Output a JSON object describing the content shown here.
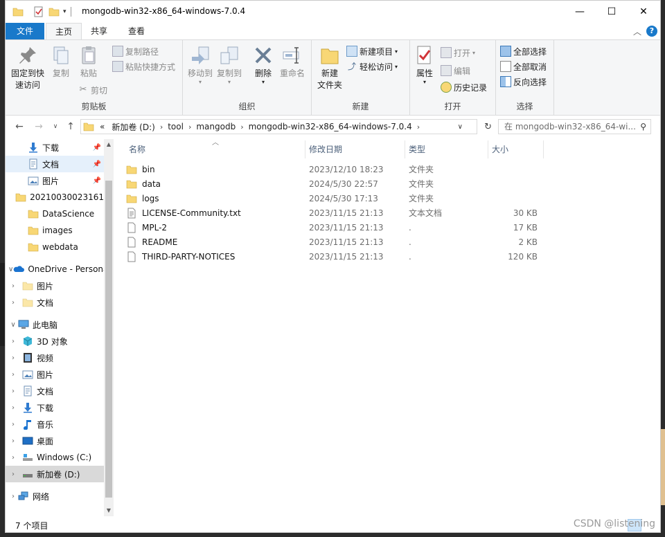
{
  "window": {
    "title": "mongodb-win32-x86_64-windows-7.0.4",
    "controls": {
      "minimize": "—",
      "maximize": "☐",
      "close": "✕"
    }
  },
  "ribbon_tabs": {
    "file": "文件",
    "home": "主页",
    "share": "共享",
    "view": "查看"
  },
  "ribbon": {
    "clipboard": {
      "pin_quick_access": [
        "固定到快",
        "速访问"
      ],
      "copy": "复制",
      "paste": "粘贴",
      "copy_path": "复制路径",
      "paste_shortcut": "粘贴快捷方式",
      "cut": "剪切",
      "label": "剪贴板"
    },
    "organize": {
      "move_to": "移动到",
      "copy_to": "复制到",
      "delete": "删除",
      "rename": "重命名",
      "label": "组织"
    },
    "new": {
      "new_folder": [
        "新建",
        "文件夹"
      ],
      "new_item": "新建项目",
      "easy_access": "轻松访问",
      "label": "新建"
    },
    "open": {
      "properties": "属性",
      "open": "打开",
      "edit": "编辑",
      "history": "历史记录",
      "label": "打开"
    },
    "select": {
      "select_all": "全部选择",
      "select_none": "全部取消",
      "invert": "反向选择",
      "label": "选择"
    }
  },
  "address": {
    "overflow": "«",
    "segments": [
      "新加卷 (D:)",
      "tool",
      "mangodb",
      "mongodb-win32-x86_64-windows-7.0.4"
    ],
    "search_placeholder": "在 mongodb-win32-x86_64-wi..."
  },
  "sidebar": {
    "quick": [
      {
        "label": "下载",
        "icon": "download-icon"
      },
      {
        "label": "文档",
        "icon": "document-icon"
      },
      {
        "label": "图片",
        "icon": "picture-icon"
      },
      {
        "label": "20210030023161",
        "icon": "folder-icon"
      },
      {
        "label": "DataScience",
        "icon": "folder-icon"
      },
      {
        "label": "images",
        "icon": "folder-icon"
      },
      {
        "label": "webdata",
        "icon": "folder-icon"
      }
    ],
    "onedrive": {
      "label": "OneDrive - Persona",
      "children": [
        "图片",
        "文档"
      ]
    },
    "thispc": {
      "label": "此电脑",
      "children": [
        {
          "label": "3D 对象",
          "icon": "3d-objects-icon"
        },
        {
          "label": "视频",
          "icon": "video-icon"
        },
        {
          "label": "图片",
          "icon": "picture-icon"
        },
        {
          "label": "文档",
          "icon": "document-icon"
        },
        {
          "label": "下载",
          "icon": "download-icon"
        },
        {
          "label": "音乐",
          "icon": "music-icon"
        },
        {
          "label": "桌面",
          "icon": "desktop-icon"
        },
        {
          "label": "Windows (C:)",
          "icon": "drive-c-icon"
        },
        {
          "label": "新加卷 (D:)",
          "icon": "drive-d-icon"
        }
      ]
    },
    "network": "网络"
  },
  "columns": {
    "name": "名称",
    "date": "修改日期",
    "type": "类型",
    "size": "大小"
  },
  "files": [
    {
      "name": "bin",
      "date": "2023/12/10 18:23",
      "type": "文件夹",
      "size": "",
      "kind": "folder"
    },
    {
      "name": "data",
      "date": "2024/5/30 22:57",
      "type": "文件夹",
      "size": "",
      "kind": "folder"
    },
    {
      "name": "logs",
      "date": "2024/5/30 17:13",
      "type": "文件夹",
      "size": "",
      "kind": "folder"
    },
    {
      "name": "LICENSE-Community.txt",
      "date": "2023/11/15 21:13",
      "type": "文本文档",
      "size": "30 KB",
      "kind": "text"
    },
    {
      "name": "MPL-2",
      "date": "2023/11/15 21:13",
      "type": ".",
      "size": "17 KB",
      "kind": "file"
    },
    {
      "name": "README",
      "date": "2023/11/15 21:13",
      "type": ".",
      "size": "2 KB",
      "kind": "file"
    },
    {
      "name": "THIRD-PARTY-NOTICES",
      "date": "2023/11/15 21:13",
      "type": ".",
      "size": "120 KB",
      "kind": "file"
    }
  ],
  "status": {
    "count": "7 个项目"
  },
  "watermark": "CSDN @listening",
  "colors": {
    "accent": "#1979ca",
    "folder": "#f8d775",
    "selected": "#e5f0fb"
  }
}
